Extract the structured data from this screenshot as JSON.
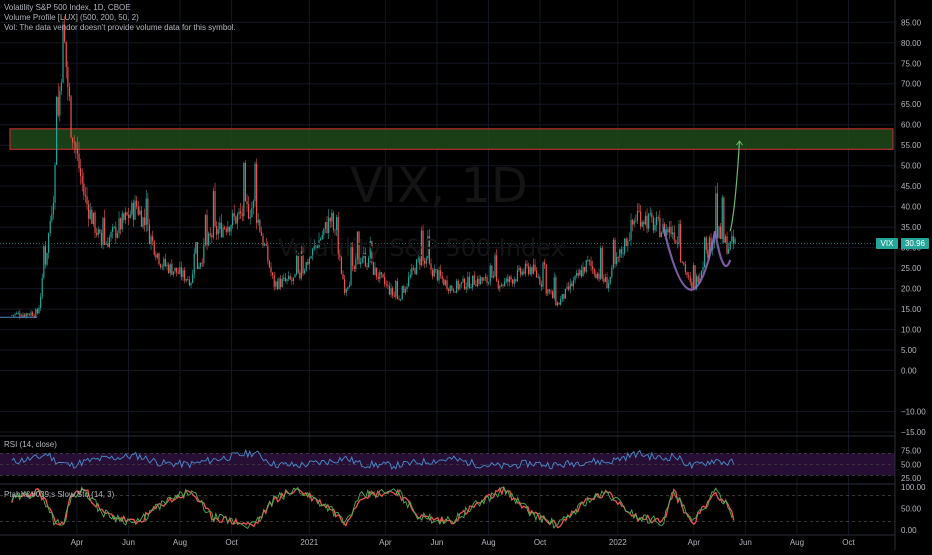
{
  "legend": {
    "line1": "Volatility S&P 500 Index, 1D, CBOE",
    "line2": "Volume Profile [LUX] (500, 200, 50, 2)",
    "line3": "Vol: The data vendor doesn't provide volume data for this symbol."
  },
  "watermark": {
    "symbol": "VIX, 1D",
    "description": "Volatility S&P 500 Index"
  },
  "price_badge": {
    "symbol": "VIX",
    "value": "30.96"
  },
  "rsi_label": "RSI (14, close)",
  "sto_label": "PtahX&#039;s Slow Sto (14, 3)",
  "colors": {
    "up": "#26a69a",
    "down": "#ef5350",
    "zone_fill": "#1e4a1a",
    "zone_border": "#d32f2f",
    "rsi_line": "#4c8ccc",
    "rsi_band": "#2a0f3a",
    "sto_k": "#4caf50",
    "sto_d": "#ef5350",
    "cup": "#8e6bbf",
    "projection": "#66bb6a"
  },
  "chart_data": [
    {
      "type": "candlestick",
      "title": "Volatility S&P 500 Index, 1D, CBOE",
      "ylim": [
        -15,
        88
      ],
      "y_ticks": [
        "85.00",
        "80.00",
        "75.00",
        "70.00",
        "65.00",
        "60.00",
        "55.00",
        "50.00",
        "45.00",
        "40.00",
        "35.00",
        "30.00",
        "25.00",
        "20.00",
        "15.00",
        "10.00",
        "5.00",
        "0.00",
        "−10.00",
        "−15.00"
      ],
      "x_ticks": [
        "Apr",
        "Jun",
        "Aug",
        "Oct",
        "2021",
        "Apr",
        "Jun",
        "Aug",
        "Oct",
        "2022",
        "Apr",
        "Jun",
        "Aug",
        "Oct"
      ],
      "x": [
        "2020-01-15",
        "2020-02-15",
        "2020-02-26",
        "2020-03-05",
        "2020-03-16",
        "2020-03-25",
        "2020-04-10",
        "2020-05-01",
        "2020-06-11",
        "2020-07-10",
        "2020-08-14",
        "2020-09-08",
        "2020-10-28",
        "2020-11-20",
        "2020-12-18",
        "2021-01-27",
        "2021-02-12",
        "2021-03-04",
        "2021-04-15",
        "2021-05-12",
        "2021-06-18",
        "2021-07-19",
        "2021-08-19",
        "2021-09-20",
        "2021-10-22",
        "2021-11-26",
        "2021-12-20",
        "2022-01-24",
        "2022-02-24",
        "2022-03-08",
        "2022-03-30",
        "2022-04-26",
        "2022-05-12",
        "2022-05-20"
      ],
      "y": [
        13.5,
        14,
        30,
        45,
        82,
        60,
        42,
        30,
        40,
        26,
        22,
        33,
        40,
        21,
        22,
        37,
        20,
        28,
        17,
        27,
        20,
        22,
        21,
        25,
        16,
        26,
        21,
        38,
        34,
        34,
        19,
        34,
        30,
        30.96
      ],
      "resistance_zone": {
        "y_bottom": 54,
        "y_top": 59
      },
      "current_price": 30.96,
      "projection_target": 56
    },
    {
      "type": "line",
      "title": "RSI (14, close)",
      "ylim": [
        25,
        80
      ],
      "y_ticks": [
        "75.00",
        "50.00",
        "25.00"
      ],
      "band": [
        30,
        70
      ],
      "values": [
        55,
        62,
        70,
        58,
        52,
        48,
        55,
        60,
        66,
        52,
        50,
        58,
        72,
        50,
        48,
        56,
        62,
        50,
        48,
        54,
        60,
        50,
        46,
        52,
        48,
        56,
        54,
        70,
        60,
        66,
        46,
        58,
        52,
        54
      ]
    },
    {
      "type": "line",
      "title": "PtahX&#039;s Slow Sto (14, 3)",
      "ylim": [
        0,
        100
      ],
      "y_ticks": [
        "100.00",
        "50.00",
        "0.00"
      ],
      "levels": [
        80,
        20
      ],
      "values": [
        70,
        90,
        60,
        20,
        10,
        80,
        95,
        40,
        15,
        60,
        90,
        30,
        10,
        70,
        95,
        50,
        15,
        80,
        90,
        30,
        20,
        60,
        95,
        40,
        10,
        70,
        85,
        30,
        20,
        90,
        15,
        88,
        60,
        20
      ]
    }
  ]
}
